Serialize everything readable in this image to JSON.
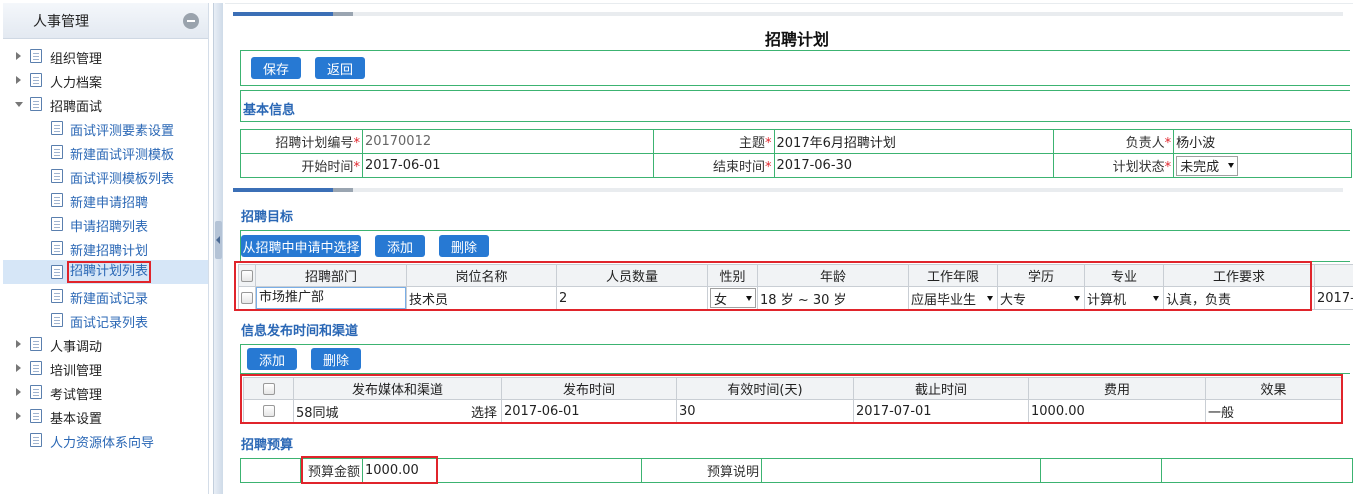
{
  "sidebar": {
    "title": "人事管理",
    "items": [
      {
        "label": "组织管理"
      },
      {
        "label": "人力档案"
      },
      {
        "label": "招聘面试"
      },
      {
        "label": "面试评测要素设置"
      },
      {
        "label": "新建面试评测模板"
      },
      {
        "label": "面试评测模板列表"
      },
      {
        "label": "新建申请招聘"
      },
      {
        "label": "申请招聘列表"
      },
      {
        "label": "新建招聘计划"
      },
      {
        "label": "招聘计划列表"
      },
      {
        "label": "新建面试记录"
      },
      {
        "label": "面试记录列表"
      },
      {
        "label": "人事调动"
      },
      {
        "label": "培训管理"
      },
      {
        "label": "考试管理"
      },
      {
        "label": "基本设置"
      },
      {
        "label": "人力资源体系向导"
      }
    ]
  },
  "page": {
    "title": "招聘计划",
    "save_label": "保存",
    "back_label": "返回"
  },
  "basic": {
    "section_title": "基本信息",
    "plan_no_label": "招聘计划编号",
    "plan_no": "20170012",
    "subject_label": "主题",
    "subject": "2017年6月招聘计划",
    "owner_label": "负责人",
    "owner": "杨小波",
    "start_label": "开始时间",
    "start": "2017-06-01",
    "end_label": "结束时间",
    "end": "2017-06-30",
    "status_label": "计划状态",
    "status": "未完成",
    "required_mark": "*"
  },
  "targets": {
    "section_title": "招聘目标",
    "select_from_apply_label": "从招聘中申请中选择",
    "add_label": "添加",
    "delete_label": "删除",
    "columns": [
      "招聘部门",
      "岗位名称",
      "人员数量",
      "性别",
      "年龄",
      "工作年限",
      "学历",
      "专业",
      "工作要求"
    ],
    "row": {
      "dept": "市场推广部",
      "position": "技术员",
      "count": "2",
      "gender": "女",
      "age_from": "18",
      "age_sep": "岁 ~",
      "age_to": "30",
      "age_unit": "岁",
      "years": "应届毕业生",
      "education": "大专",
      "major": "计算机",
      "requirement": "认真，负责",
      "overflow": "2017-"
    }
  },
  "channels": {
    "section_title": "信息发布时间和渠道",
    "add_label": "添加",
    "delete_label": "删除",
    "columns": [
      "发布媒体和渠道",
      "发布时间",
      "有效时间(天)",
      "截止时间",
      "费用",
      "效果"
    ],
    "row": {
      "media": "58同城",
      "select_label": "选择",
      "publish": "2017-06-01",
      "valid_days": "30",
      "deadline": "2017-07-01",
      "cost": "1000.00",
      "effect": "一般"
    }
  },
  "budget": {
    "section_title": "招聘预算",
    "amount_label": "预算金额",
    "amount": "1000.00",
    "note_label": "预算说明"
  }
}
